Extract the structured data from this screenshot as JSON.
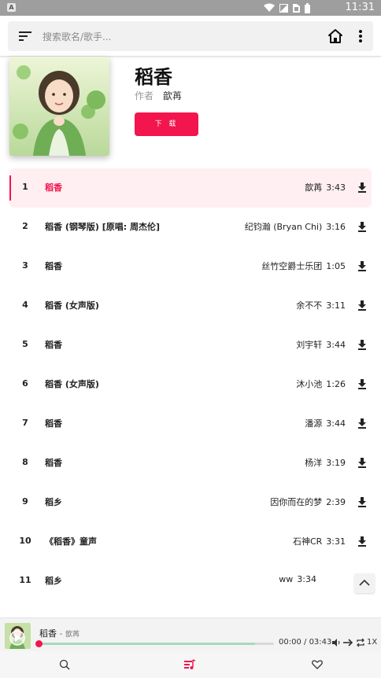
{
  "status_bar": {
    "app_badge": "A",
    "time": "11:31",
    "icons": [
      "wifi-icon",
      "signal-icon",
      "sim-icon",
      "battery-icon"
    ]
  },
  "search": {
    "placeholder": "搜索歌名/歌手...",
    "icons": [
      "menu-icon",
      "home-icon",
      "more-vertical-icon"
    ]
  },
  "album": {
    "title": "稻香",
    "author_label": "作者",
    "author": "歆苒",
    "download_label": "下 载"
  },
  "songs": [
    {
      "index": "1",
      "title": "稻香",
      "artist": "歆苒",
      "duration": "3:43",
      "active": true
    },
    {
      "index": "2",
      "title": "稻香 (钢琴版) [原唱: 周杰伦]",
      "artist": "纪钧瀚 (Bryan Chi)",
      "duration": "3:16"
    },
    {
      "index": "3",
      "title": "稻香",
      "artist": "丝竹空爵士乐团",
      "duration": "1:05"
    },
    {
      "index": "4",
      "title": "稻香 (女声版)",
      "artist": "余不不",
      "duration": "3:11"
    },
    {
      "index": "5",
      "title": "稻香",
      "artist": "刘宇轩",
      "duration": "3:44"
    },
    {
      "index": "6",
      "title": "稻香 (女声版)",
      "artist": "沐小池",
      "duration": "1:26"
    },
    {
      "index": "7",
      "title": "稻香",
      "artist": "潘源",
      "duration": "3:44"
    },
    {
      "index": "8",
      "title": "稻香",
      "artist": "杨洋",
      "duration": "3:19"
    },
    {
      "index": "9",
      "title": "稻乡",
      "artist": "因你而在的梦",
      "duration": "2:39"
    },
    {
      "index": "10",
      "title": "《稻香》童声",
      "artist": "石神CR",
      "duration": "3:31"
    },
    {
      "index": "11",
      "title": "稻乡",
      "artist": "ww",
      "duration": "3:34"
    }
  ],
  "player": {
    "title": "稻香",
    "separator": " - ",
    "artist": "歆苒",
    "elapsed": "00:00",
    "total": "03:43",
    "progress": 0.92,
    "speed": "1X",
    "controls": [
      "volume-icon",
      "sequential-play-icon",
      "repeat-icon"
    ]
  },
  "nav": {
    "items": [
      "search-icon",
      "playlist-icon",
      "heart-icon"
    ],
    "active_index": 1
  },
  "colors": {
    "accent": "#f2154e",
    "active_row_bg": "#ffeff2",
    "progress_fill": "#a8d8c0"
  }
}
